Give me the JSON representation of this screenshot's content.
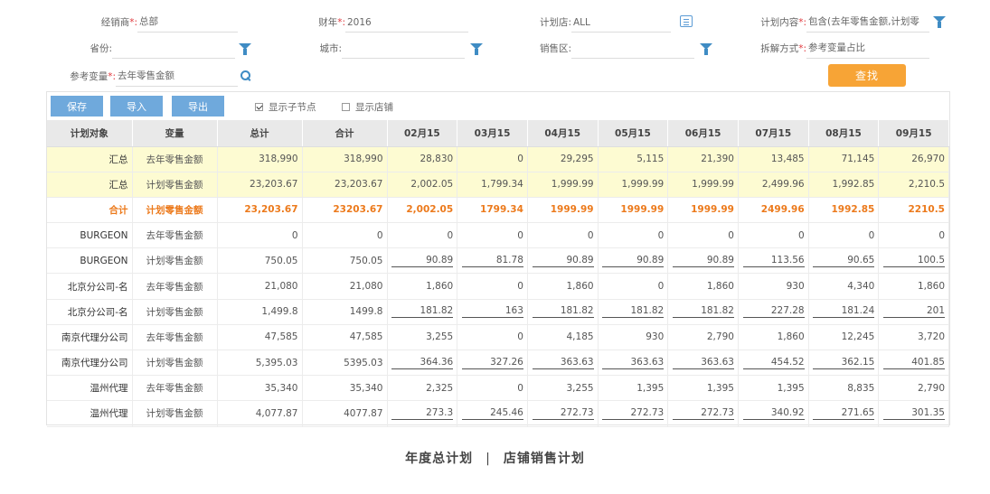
{
  "filters": {
    "dealer": {
      "label": "经销商",
      "value": "总部"
    },
    "fiscal_year": {
      "label": "财年",
      "value": "2016"
    },
    "plan_store": {
      "label": "计划店",
      "value": "ALL"
    },
    "plan_content": {
      "label": "计划内容",
      "value": "包含(去年零售金额,计划零"
    },
    "province": {
      "label": "省份:",
      "value": ""
    },
    "city": {
      "label": "城市:",
      "value": ""
    },
    "sales_area": {
      "label": "销售区:",
      "value": ""
    },
    "split_method": {
      "label": "拆解方式",
      "value": "参考变量占比"
    },
    "ref_variable": {
      "label": "参考变量",
      "value": "去年零售金额"
    },
    "required_mark": "*:",
    "search_label": "查找"
  },
  "toolbar": {
    "save": "保存",
    "import": "导入",
    "export": "导出",
    "show_children": "显示子节点",
    "show_stores": "显示店铺"
  },
  "table": {
    "headers": [
      "计划对象",
      "变量",
      "总计",
      "合计",
      "02月15",
      "03月15",
      "04月15",
      "05月15",
      "06月15",
      "07月15",
      "08月15",
      "09月15"
    ],
    "rows": [
      {
        "type": "yellow",
        "cells": [
          "汇总",
          "去年零售金额",
          "318,990",
          "318,990",
          "28,830",
          "0",
          "29,295",
          "5,115",
          "21,390",
          "13,485",
          "71,145",
          "26,970"
        ]
      },
      {
        "type": "yellow",
        "cells": [
          "汇总",
          "计划零售金额",
          "23,203.67",
          "23,203.67",
          "2,002.05",
          "1,799.34",
          "1,999.99",
          "1,999.99",
          "1,999.99",
          "2,499.96",
          "1,992.85",
          "2,210.5"
        ]
      },
      {
        "type": "sum",
        "cells": [
          "合计",
          "计划零售金额",
          "23,203.67",
          "23203.67",
          "2,002.05",
          "1799.34",
          "1999.99",
          "1999.99",
          "1999.99",
          "2499.96",
          "1992.85",
          "2210.5"
        ]
      },
      {
        "type": "normal",
        "cells": [
          "BURGEON",
          "去年零售金额",
          "0",
          "0",
          "0",
          "0",
          "0",
          "0",
          "0",
          "0",
          "0",
          "0"
        ]
      },
      {
        "type": "input",
        "cells": [
          "BURGEON",
          "计划零售金额",
          "750.05",
          "750.05",
          "90.89",
          "81.78",
          "90.89",
          "90.89",
          "90.89",
          "113.56",
          "90.65",
          "100.5"
        ]
      },
      {
        "type": "normal",
        "cells": [
          "北京分公司-名",
          "去年零售金额",
          "21,080",
          "21,080",
          "1,860",
          "0",
          "1,860",
          "0",
          "1,860",
          "930",
          "4,340",
          "1,860"
        ]
      },
      {
        "type": "input",
        "cells": [
          "北京分公司-名",
          "计划零售金额",
          "1,499.8",
          "1499.8",
          "181.82",
          "163",
          "181.82",
          "181.82",
          "181.82",
          "227.28",
          "181.24",
          "201"
        ]
      },
      {
        "type": "normal",
        "cells": [
          "南京代理分公司",
          "去年零售金额",
          "47,585",
          "47,585",
          "3,255",
          "0",
          "4,185",
          "930",
          "2,790",
          "1,860",
          "12,245",
          "3,720"
        ]
      },
      {
        "type": "input",
        "cells": [
          "南京代理分公司",
          "计划零售金额",
          "5,395.03",
          "5395.03",
          "364.36",
          "327.26",
          "363.63",
          "363.63",
          "363.63",
          "454.52",
          "362.15",
          "401.85"
        ]
      },
      {
        "type": "normal",
        "cells": [
          "温州代理",
          "去年零售金额",
          "35,340",
          "35,340",
          "2,325",
          "0",
          "3,255",
          "1,395",
          "1,395",
          "1,395",
          "8,835",
          "2,790"
        ]
      },
      {
        "type": "input",
        "cells": [
          "温州代理",
          "计划零售金额",
          "4,077.87",
          "4077.87",
          "273.3",
          "245.46",
          "272.73",
          "272.73",
          "272.73",
          "340.92",
          "271.65",
          "301.35"
        ]
      }
    ]
  },
  "footer": {
    "left": "年度总计划",
    "separator": "|",
    "right": "店铺销售计划"
  },
  "colors": {
    "accent_blue": "#6fa9dc",
    "search_orange": "#f7a436",
    "sum_orange": "#ec7a1c",
    "highlight_yellow": "#fdfbd2"
  }
}
